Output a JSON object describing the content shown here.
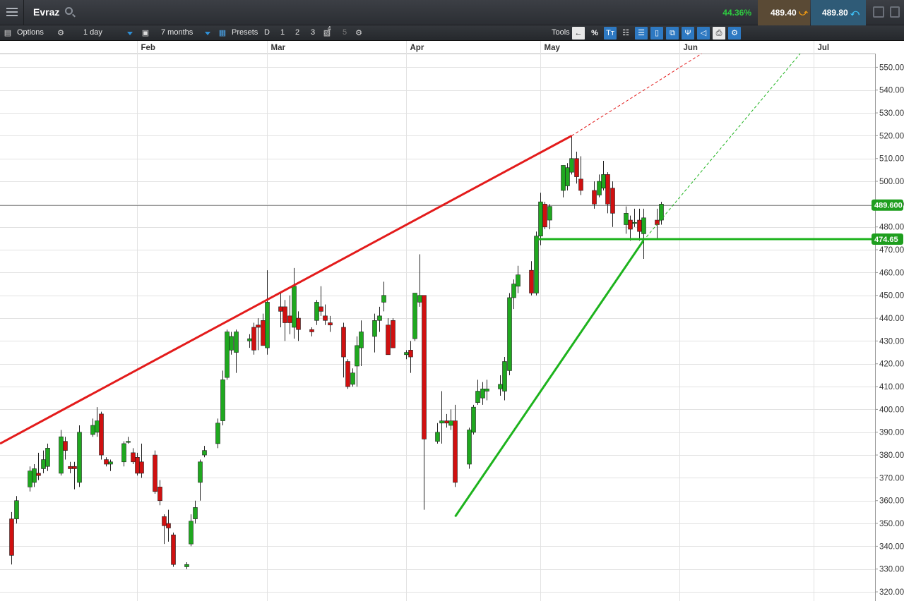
{
  "header": {
    "symbol": "Evraz",
    "change_pct": "44.36%",
    "sell_price": "489.40",
    "buy_price": "489.80",
    "icons": [
      "hamburger-menu-icon",
      "search-icon",
      "down-arrow-icon",
      "up-arrow-icon",
      "restore-window-icon",
      "detach-window-icon"
    ]
  },
  "toolbar": {
    "options_label": "Options",
    "interval_value": "1 day",
    "range_value": "7 months",
    "presets_label": "Presets",
    "preset_d": "D",
    "preset_1": "1",
    "preset_2": "2",
    "preset_3": "3",
    "preset_4_sup": "4",
    "preset_5": "5",
    "tools_label": "Tools",
    "percent_label": "%",
    "text_tool_label": "Tт",
    "icons": [
      "sidebar-icon",
      "settings-gear-icon",
      "lock-icon",
      "calendar-icon",
      "save-icon",
      "back-arrow-icon",
      "crosshair-icon",
      "fibonacci-icon",
      "candle-icon",
      "layers-icon",
      "pitchfork-icon",
      "label-tag-icon",
      "print-icon",
      "settings-tools-icon"
    ]
  },
  "colors": {
    "up": "#1fa81f",
    "down": "#d01010",
    "resistance": "#e31b1b",
    "support": "#1db31d",
    "price_tag": "#1e9e1e"
  },
  "chart_data": {
    "type": "candlestick",
    "title": "",
    "months": [
      {
        "label": "Feb",
        "date": "2024-02-01"
      },
      {
        "label": "Mar",
        "date": "2024-03-01"
      },
      {
        "label": "Apr",
        "date": "2024-04-01"
      },
      {
        "label": "May",
        "date": "2024-05-01"
      },
      {
        "label": "Jun",
        "date": "2024-06-01"
      },
      {
        "label": "Jul",
        "date": "2024-07-01"
      }
    ],
    "y_ticks": [
      "550.00",
      "540.00",
      "530.00",
      "520.00",
      "510.00",
      "500.00",
      "490.00",
      "480.00",
      "470.00",
      "460.00",
      "450.00",
      "440.00",
      "430.00",
      "420.00",
      "410.00",
      "400.00",
      "390.00",
      "380.00",
      "370.00",
      "360.00",
      "350.00",
      "340.00",
      "330.00",
      "320.00"
    ],
    "y_range": [
      316,
      556
    ],
    "grid": true,
    "last_price_label": "489.600",
    "last_price": 489.6,
    "level_label": "474.65",
    "level": 474.65,
    "candles": [
      {
        "date": "2024-01-04",
        "o": 352,
        "h": 355,
        "l": 332,
        "c": 336
      },
      {
        "date": "2024-01-05",
        "o": 352,
        "h": 362,
        "l": 350,
        "c": 360
      },
      {
        "date": "2024-01-08",
        "o": 366,
        "h": 375,
        "l": 364,
        "c": 373
      },
      {
        "date": "2024-01-09",
        "o": 368,
        "h": 376,
        "l": 366,
        "c": 374
      },
      {
        "date": "2024-01-10",
        "o": 372,
        "h": 381,
        "l": 369,
        "c": 371
      },
      {
        "date": "2024-01-11",
        "o": 374,
        "h": 382,
        "l": 372,
        "c": 378
      },
      {
        "date": "2024-01-12",
        "o": 375,
        "h": 385,
        "l": 373,
        "c": 383
      },
      {
        "date": "2024-01-15",
        "o": 372,
        "h": 391,
        "l": 371,
        "c": 388
      },
      {
        "date": "2024-01-16",
        "o": 386,
        "h": 388,
        "l": 378,
        "c": 382
      },
      {
        "date": "2024-01-17",
        "o": 375,
        "h": 377,
        "l": 372,
        "c": 374
      },
      {
        "date": "2024-01-18",
        "o": 375,
        "h": 377,
        "l": 365,
        "c": 374
      },
      {
        "date": "2024-01-19",
        "o": 368,
        "h": 393,
        "l": 366,
        "c": 390
      },
      {
        "date": "2024-01-22",
        "o": 389,
        "h": 396,
        "l": 388,
        "c": 393
      },
      {
        "date": "2024-01-23",
        "o": 390,
        "h": 401,
        "l": 388,
        "c": 395
      },
      {
        "date": "2024-01-24",
        "o": 398,
        "h": 399,
        "l": 378,
        "c": 380
      },
      {
        "date": "2024-01-25",
        "o": 378,
        "h": 379,
        "l": 375,
        "c": 376
      },
      {
        "date": "2024-01-26",
        "o": 376,
        "h": 378,
        "l": 373,
        "c": 377
      },
      {
        "date": "2024-01-29",
        "o": 377,
        "h": 386,
        "l": 375,
        "c": 385
      },
      {
        "date": "2024-01-30",
        "o": 386,
        "h": 388,
        "l": 385,
        "c": 386
      },
      {
        "date": "2024-01-31",
        "o": 381,
        "h": 383,
        "l": 376,
        "c": 377
      },
      {
        "date": "2024-02-01",
        "o": 379,
        "h": 381,
        "l": 371,
        "c": 372
      },
      {
        "date": "2024-02-02",
        "o": 377,
        "h": 385,
        "l": 370,
        "c": 372
      },
      {
        "date": "2024-02-05",
        "o": 380,
        "h": 382,
        "l": 363,
        "c": 364
      },
      {
        "date": "2024-02-06",
        "o": 366,
        "h": 369,
        "l": 358,
        "c": 360
      },
      {
        "date": "2024-02-07",
        "o": 353,
        "h": 354,
        "l": 341,
        "c": 349
      },
      {
        "date": "2024-02-08",
        "o": 350,
        "h": 356,
        "l": 342,
        "c": 348
      },
      {
        "date": "2024-02-09",
        "o": 345,
        "h": 346,
        "l": 331,
        "c": 332
      },
      {
        "date": "2024-02-12",
        "o": 331,
        "h": 333,
        "l": 330,
        "c": 332
      },
      {
        "date": "2024-02-13",
        "o": 341,
        "h": 354,
        "l": 340,
        "c": 351
      },
      {
        "date": "2024-02-14",
        "o": 352,
        "h": 360,
        "l": 350,
        "c": 357
      },
      {
        "date": "2024-02-15",
        "o": 368,
        "h": 378,
        "l": 360,
        "c": 377
      },
      {
        "date": "2024-02-16",
        "o": 380,
        "h": 384,
        "l": 379,
        "c": 382
      },
      {
        "date": "2024-02-19",
        "o": 385,
        "h": 396,
        "l": 383,
        "c": 394
      },
      {
        "date": "2024-02-20",
        "o": 395,
        "h": 417,
        "l": 393,
        "c": 413
      },
      {
        "date": "2024-02-21",
        "o": 414,
        "h": 435,
        "l": 413,
        "c": 434
      },
      {
        "date": "2024-02-22",
        "o": 426,
        "h": 434,
        "l": 424,
        "c": 432
      },
      {
        "date": "2024-02-23",
        "o": 425,
        "h": 435,
        "l": 416,
        "c": 434
      },
      {
        "date": "2024-02-26",
        "o": 430,
        "h": 433,
        "l": 427,
        "c": 431
      },
      {
        "date": "2024-02-27",
        "o": 436,
        "h": 438,
        "l": 424,
        "c": 426
      },
      {
        "date": "2024-02-28",
        "o": 437,
        "h": 440,
        "l": 426,
        "c": 436
      },
      {
        "date": "2024-02-29",
        "o": 439,
        "h": 442,
        "l": 428,
        "c": 428
      },
      {
        "date": "2024-03-01",
        "o": 427,
        "h": 461,
        "l": 424,
        "c": 447
      },
      {
        "date": "2024-03-04",
        "o": 445,
        "h": 451,
        "l": 436,
        "c": 443
      },
      {
        "date": "2024-03-05",
        "o": 445,
        "h": 448,
        "l": 430,
        "c": 438
      },
      {
        "date": "2024-03-06",
        "o": 441,
        "h": 450,
        "l": 433,
        "c": 438
      },
      {
        "date": "2024-03-07",
        "o": 436,
        "h": 462,
        "l": 431,
        "c": 454
      },
      {
        "date": "2024-03-08",
        "o": 440,
        "h": 443,
        "l": 430,
        "c": 435
      },
      {
        "date": "2024-03-11",
        "o": 435,
        "h": 436,
        "l": 432,
        "c": 434
      },
      {
        "date": "2024-03-12",
        "o": 439,
        "h": 448,
        "l": 437,
        "c": 447
      },
      {
        "date": "2024-03-13",
        "o": 445,
        "h": 454,
        "l": 441,
        "c": 443
      },
      {
        "date": "2024-03-14",
        "o": 441,
        "h": 446,
        "l": 437,
        "c": 439
      },
      {
        "date": "2024-03-15",
        "o": 438,
        "h": 441,
        "l": 434,
        "c": 437
      },
      {
        "date": "2024-03-18",
        "o": 436,
        "h": 438,
        "l": 414,
        "c": 423
      },
      {
        "date": "2024-03-19",
        "o": 421,
        "h": 422,
        "l": 409,
        "c": 410
      },
      {
        "date": "2024-03-20",
        "o": 411,
        "h": 418,
        "l": 410,
        "c": 416
      },
      {
        "date": "2024-03-21",
        "o": 419,
        "h": 432,
        "l": 410,
        "c": 428
      },
      {
        "date": "2024-03-22",
        "o": 427,
        "h": 439,
        "l": 419,
        "c": 434
      },
      {
        "date": "2024-03-25",
        "o": 432,
        "h": 442,
        "l": 425,
        "c": 439
      },
      {
        "date": "2024-03-26",
        "o": 439,
        "h": 445,
        "l": 434,
        "c": 441
      },
      {
        "date": "2024-03-27",
        "o": 447,
        "h": 456,
        "l": 443,
        "c": 450
      },
      {
        "date": "2024-03-28",
        "o": 437,
        "h": 440,
        "l": 424,
        "c": 424
      },
      {
        "date": "2024-03-29",
        "o": 439,
        "h": 440,
        "l": 427,
        "c": 427
      },
      {
        "date": "2024-04-01",
        "o": 424,
        "h": 426,
        "l": 422,
        "c": 425
      },
      {
        "date": "2024-04-02",
        "o": 426,
        "h": 430,
        "l": 416,
        "c": 423
      },
      {
        "date": "2024-04-03",
        "o": 431,
        "h": 445,
        "l": 430,
        "c": 451
      },
      {
        "date": "2024-04-04",
        "o": 447,
        "h": 468,
        "l": 445,
        "c": 450
      },
      {
        "date": "2024-04-05",
        "o": 450,
        "h": 450,
        "l": 356,
        "c": 387
      },
      {
        "date": "2024-04-08",
        "o": 386,
        "h": 394,
        "l": 385,
        "c": 390
      },
      {
        "date": "2024-04-09",
        "o": 394,
        "h": 408,
        "l": 385,
        "c": 395
      },
      {
        "date": "2024-04-10",
        "o": 395,
        "h": 398,
        "l": 392,
        "c": 394
      },
      {
        "date": "2024-04-11",
        "o": 393,
        "h": 400,
        "l": 391,
        "c": 395
      },
      {
        "date": "2024-04-12",
        "o": 395,
        "h": 402,
        "l": 366,
        "c": 368
      },
      {
        "date": "2024-04-15",
        "o": 376,
        "h": 392,
        "l": 374,
        "c": 391
      },
      {
        "date": "2024-04-16",
        "o": 390,
        "h": 402,
        "l": 389,
        "c": 401
      },
      {
        "date": "2024-04-17",
        "o": 403,
        "h": 413,
        "l": 402,
        "c": 408
      },
      {
        "date": "2024-04-18",
        "o": 405,
        "h": 412,
        "l": 402,
        "c": 409
      },
      {
        "date": "2024-04-19",
        "o": 408,
        "h": 413,
        "l": 404,
        "c": 409
      },
      {
        "date": "2024-04-22",
        "o": 409,
        "h": 415,
        "l": 406,
        "c": 411
      },
      {
        "date": "2024-04-23",
        "o": 408,
        "h": 423,
        "l": 404,
        "c": 421
      },
      {
        "date": "2024-04-24",
        "o": 417,
        "h": 451,
        "l": 415,
        "c": 449
      },
      {
        "date": "2024-04-25",
        "o": 449,
        "h": 457,
        "l": 444,
        "c": 455
      },
      {
        "date": "2024-04-26",
        "o": 454,
        "h": 463,
        "l": 451,
        "c": 459
      },
      {
        "date": "2024-04-29",
        "o": 461,
        "h": 465,
        "l": 450,
        "c": 451
      },
      {
        "date": "2024-04-30",
        "o": 451,
        "h": 478,
        "l": 450,
        "c": 476
      },
      {
        "date": "2024-05-01",
        "o": 476,
        "h": 495,
        "l": 472,
        "c": 491
      },
      {
        "date": "2024-05-02",
        "o": 490,
        "h": 491,
        "l": 479,
        "c": 480
      },
      {
        "date": "2024-05-03",
        "o": 483,
        "h": 490,
        "l": 479,
        "c": 489
      },
      {
        "date": "2024-05-06",
        "o": 496,
        "h": 507,
        "l": 493,
        "c": 507
      },
      {
        "date": "2024-05-07",
        "o": 498,
        "h": 508,
        "l": 496,
        "c": 506
      },
      {
        "date": "2024-05-08",
        "o": 504,
        "h": 520,
        "l": 503,
        "c": 510
      },
      {
        "date": "2024-05-09",
        "o": 510,
        "h": 513,
        "l": 499,
        "c": 502
      },
      {
        "date": "2024-05-10",
        "o": 501,
        "h": 511,
        "l": 494,
        "c": 496
      },
      {
        "date": "2024-05-13",
        "o": 496,
        "h": 500,
        "l": 488,
        "c": 490
      },
      {
        "date": "2024-05-14",
        "o": 494,
        "h": 503,
        "l": 493,
        "c": 500
      },
      {
        "date": "2024-05-15",
        "o": 497,
        "h": 509,
        "l": 496,
        "c": 503
      },
      {
        "date": "2024-05-16",
        "o": 503,
        "h": 504,
        "l": 486,
        "c": 490
      },
      {
        "date": "2024-05-17",
        "o": 497,
        "h": 500,
        "l": 480,
        "c": 486
      },
      {
        "date": "2024-05-20",
        "o": 481,
        "h": 489,
        "l": 477,
        "c": 486
      },
      {
        "date": "2024-05-21",
        "o": 483,
        "h": 485,
        "l": 474,
        "c": 479
      },
      {
        "date": "2024-05-22",
        "o": 482,
        "h": 488,
        "l": 480,
        "c": 482
      },
      {
        "date": "2024-05-23",
        "o": 483,
        "h": 488,
        "l": 474,
        "c": 478
      },
      {
        "date": "2024-05-24",
        "o": 477,
        "h": 488,
        "l": 466,
        "c": 484
      },
      {
        "date": "2024-05-27",
        "o": 483,
        "h": 488,
        "l": 475,
        "c": 481
      },
      {
        "date": "2024-05-28",
        "o": 483,
        "h": 491,
        "l": 481,
        "c": 490
      }
    ],
    "trendlines": [
      {
        "name": "resistance",
        "from": {
          "date": "2024-01-01",
          "y": 385
        },
        "to": {
          "date": "2024-05-08",
          "y": 520
        },
        "ext_to": {
          "date": "2024-06-06",
          "y": 556
        }
      },
      {
        "name": "support",
        "from": {
          "date": "2024-04-12",
          "y": 353
        },
        "to": {
          "date": "2024-05-24",
          "y": 474
        },
        "ext_to": {
          "date": "2024-06-28",
          "y": 556
        }
      },
      {
        "name": "horizontal-level",
        "from": {
          "date": "2024-04-30",
          "y": 474.65
        },
        "to": {
          "date": "2024-07-04",
          "y": 474.65
        }
      }
    ]
  }
}
